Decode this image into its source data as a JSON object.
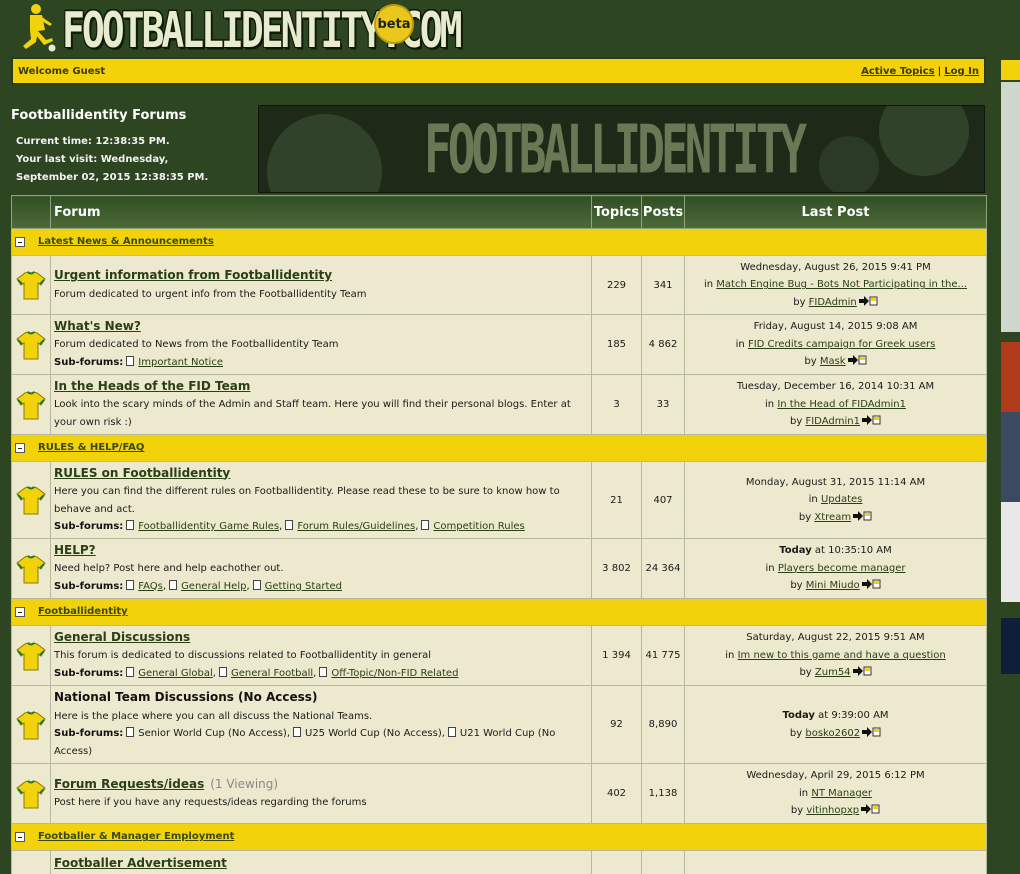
{
  "header": {
    "logo_text": "FOOTBALLIDENTITY.COM",
    "beta": "beta"
  },
  "welcome": {
    "text": "Welcome Guest",
    "active_topics": "Active Topics",
    "separator": "|",
    "log_in": "Log In"
  },
  "info": {
    "title": "Footballidentity Forums",
    "current_time": "Current time: 12:38:35 PM.",
    "last_visit_1": "Your last visit: Wednesday,",
    "last_visit_2": "September 02, 2015 12:38:35 PM."
  },
  "banner": {
    "text": "FOOTBALLIDENTITY"
  },
  "table": {
    "headers": {
      "forum": "Forum",
      "topics": "Topics",
      "posts": "Posts",
      "last_post": "Last Post"
    },
    "categories": [
      {
        "name": "Latest News & Announcements",
        "forums": [
          {
            "name": "Urgent information from Footballidentity",
            "desc": "Forum dedicated to urgent info from the Footballidentity Team",
            "topics": "229",
            "posts": "341",
            "date": "Wednesday, August 26, 2015 9:41 PM",
            "in": "in",
            "topic": "Match Engine Bug - Bots Not Participating in the...",
            "by": "by",
            "user": "FIDAdmin"
          },
          {
            "name": "What's New?",
            "desc": "Forum dedicated to News from the Footballidentity Team",
            "sub_label": "Sub-forums:",
            "subs": [
              "Important Notice"
            ],
            "topics": "185",
            "posts": "4 862",
            "date": "Friday, August 14, 2015 9:08 AM",
            "in": "in",
            "topic": "FID Credits campaign for Greek users",
            "by": "by",
            "user": "Mask"
          },
          {
            "name": "In the Heads of the FID Team",
            "desc": "Look into the scary minds of the Admin and Staff team. Here you will find their personal blogs. Enter at your own risk :)",
            "topics": "3",
            "posts": "33",
            "date": "Tuesday, December 16, 2014 10:31 AM",
            "in": "in",
            "topic": "In the Head of FIDAdmin1",
            "by": "by",
            "user": "FIDAdmin1"
          }
        ]
      },
      {
        "name": "RULES & HELP/FAQ",
        "forums": [
          {
            "name": "RULES on Footballidentity",
            "desc": "Here you can find the different rules on Footballidentity. Please read these to be sure to know how to behave and act.",
            "sub_label": "Sub-forums:",
            "subs": [
              "Footballidentity Game Rules",
              "Forum Rules/Guidelines",
              "Competition Rules"
            ],
            "topics": "21",
            "posts": "407",
            "date": "Monday, August 31, 2015 11:14 AM",
            "in": "in",
            "topic": "Updates",
            "by": "by",
            "user": "Xtream"
          },
          {
            "name": "HELP?",
            "desc": "Need help? Post here and help eachother out.",
            "sub_label": "Sub-forums:",
            "subs": [
              "FAQs",
              "General Help",
              "Getting Started"
            ],
            "topics": "3 802",
            "posts": "24 364",
            "date_bold": "Today",
            "date_rest": " at 10:35:10 AM",
            "in": "in",
            "topic": "Players become manager",
            "by": "by",
            "user": "Mini Miudo"
          }
        ]
      },
      {
        "name": "Footballidentity",
        "forums": [
          {
            "name": "General Discussions",
            "desc": "This forum is dedicated to discussions related to Footballidentity in general",
            "sub_label": "Sub-forums:",
            "subs": [
              "General Global",
              "General Football",
              "Off-Topic/Non-FID Related"
            ],
            "topics": "1 394",
            "posts": "41 775",
            "date": "Saturday, August 22, 2015 9:51 AM",
            "in": "in",
            "topic": "Im new to this game and have a question",
            "by": "by",
            "user": "Zum54"
          },
          {
            "name": "National Team Discussions (No Access)",
            "desc": "Here is the place where you can all discuss the National Teams.",
            "sub_label": "Sub-forums:",
            "subs_plain": [
              "Senior World Cup (No Access)",
              "U25 World Cup (No Access)",
              "U21 World Cup (No Access)"
            ],
            "topics": "92",
            "posts": "8,890",
            "date_bold": "Today",
            "date_rest": " at 9:39:00 AM",
            "by": "by",
            "user": "bosko2602"
          },
          {
            "name": "Forum Requests/ideas",
            "viewing": "(1 Viewing)",
            "desc": "Post here if you have any requests/ideas regarding the forums",
            "topics": "402",
            "posts": "1,138",
            "date": "Wednesday, April 29, 2015 6:12 PM",
            "in": "in",
            "topic": "NT Manager",
            "by": "by",
            "user": "vitinhopxp"
          }
        ]
      },
      {
        "name": "Footballer & Manager Employment",
        "forums": [
          {
            "name": "Footballer Advertisement"
          }
        ]
      }
    ]
  }
}
